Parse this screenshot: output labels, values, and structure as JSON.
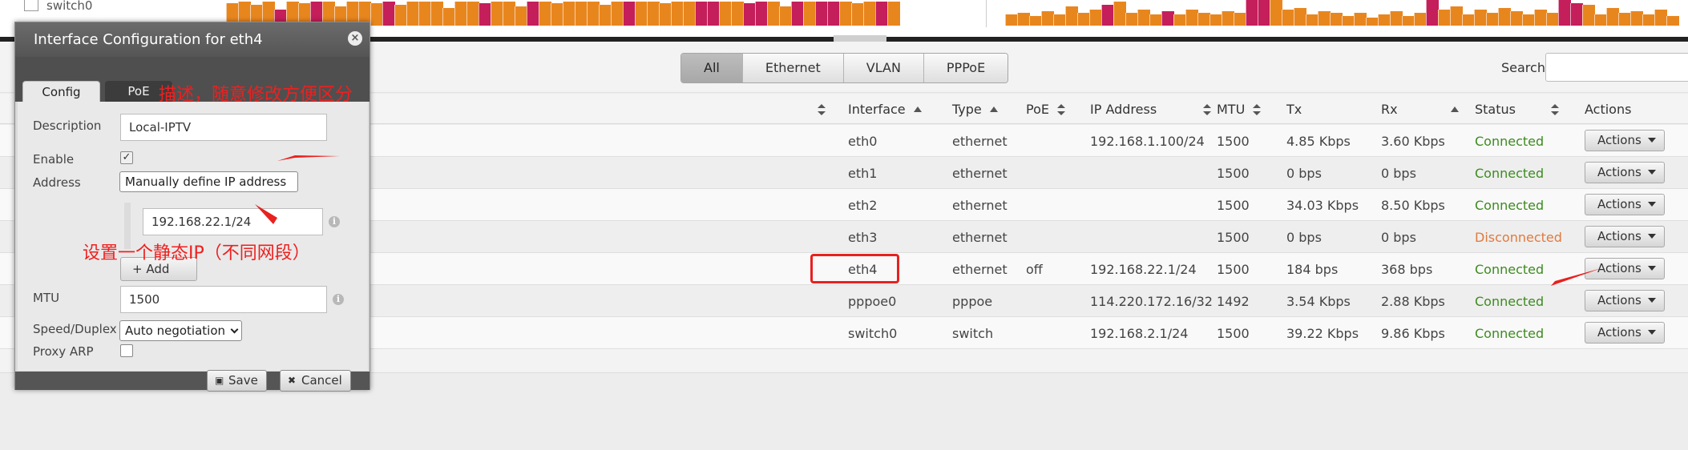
{
  "graphs": {
    "legend_label": "switch0",
    "colors": {
      "tx": "#e8861e",
      "rx": "#c41e5b"
    },
    "left_bars": [
      {
        "c": "tx",
        "h": 28
      },
      {
        "c": "tx",
        "h": 30
      },
      {
        "c": "tx",
        "h": 26
      },
      {
        "c": "tx",
        "h": 30
      },
      {
        "c": "rx",
        "h": 20
      },
      {
        "c": "tx",
        "h": 30
      },
      {
        "c": "tx",
        "h": 28
      },
      {
        "c": "rx",
        "h": 30
      },
      {
        "c": "tx",
        "h": 30
      },
      {
        "c": "tx",
        "h": 24
      },
      {
        "c": "tx",
        "h": 30
      },
      {
        "c": "tx",
        "h": 30
      },
      {
        "c": "tx",
        "h": 28
      },
      {
        "c": "rx",
        "h": 30
      },
      {
        "c": "tx",
        "h": 26
      },
      {
        "c": "tx",
        "h": 30
      },
      {
        "c": "tx",
        "h": 30
      },
      {
        "c": "tx",
        "h": 30
      },
      {
        "c": "tx",
        "h": 22
      },
      {
        "c": "tx",
        "h": 30
      },
      {
        "c": "tx",
        "h": 30
      },
      {
        "c": "rx",
        "h": 28
      },
      {
        "c": "tx",
        "h": 30
      },
      {
        "c": "tx",
        "h": 30
      },
      {
        "c": "tx",
        "h": 24
      },
      {
        "c": "rx",
        "h": 30
      },
      {
        "c": "tx",
        "h": 30
      },
      {
        "c": "tx",
        "h": 28
      },
      {
        "c": "tx",
        "h": 30
      },
      {
        "c": "tx",
        "h": 30
      },
      {
        "c": "tx",
        "h": 30
      },
      {
        "c": "tx",
        "h": 26
      },
      {
        "c": "tx",
        "h": 30
      },
      {
        "c": "rx",
        "h": 30
      },
      {
        "c": "tx",
        "h": 30
      },
      {
        "c": "tx",
        "h": 30
      },
      {
        "c": "tx",
        "h": 28
      },
      {
        "c": "tx",
        "h": 30
      },
      {
        "c": "tx",
        "h": 30
      },
      {
        "c": "rx",
        "h": 30
      },
      {
        "c": "rx",
        "h": 30
      },
      {
        "c": "tx",
        "h": 30
      },
      {
        "c": "tx",
        "h": 30
      },
      {
        "c": "rx",
        "h": 28
      },
      {
        "c": "rx",
        "h": 30
      },
      {
        "c": "tx",
        "h": 30
      },
      {
        "c": "tx",
        "h": 24
      },
      {
        "c": "rx",
        "h": 30
      },
      {
        "c": "tx",
        "h": 30
      },
      {
        "c": "rx",
        "h": 30
      },
      {
        "c": "rx",
        "h": 30
      },
      {
        "c": "tx",
        "h": 30
      },
      {
        "c": "tx",
        "h": 28
      },
      {
        "c": "tx",
        "h": 30
      },
      {
        "c": "rx",
        "h": 30
      },
      {
        "c": "tx",
        "h": 30
      }
    ],
    "right_bars": [
      {
        "c": "tx",
        "h": 14
      },
      {
        "c": "tx",
        "h": 16
      },
      {
        "c": "tx",
        "h": 12
      },
      {
        "c": "tx",
        "h": 18
      },
      {
        "c": "tx",
        "h": 14
      },
      {
        "c": "tx",
        "h": 24
      },
      {
        "c": "tx",
        "h": 16
      },
      {
        "c": "tx",
        "h": 20
      },
      {
        "c": "rx",
        "h": 26
      },
      {
        "c": "tx",
        "h": 30
      },
      {
        "c": "tx",
        "h": 16
      },
      {
        "c": "tx",
        "h": 20
      },
      {
        "c": "tx",
        "h": 14
      },
      {
        "c": "rx",
        "h": 18
      },
      {
        "c": "tx",
        "h": 14
      },
      {
        "c": "tx",
        "h": 20
      },
      {
        "c": "tx",
        "h": 16
      },
      {
        "c": "tx",
        "h": 14
      },
      {
        "c": "tx",
        "h": 18
      },
      {
        "c": "tx",
        "h": 16
      },
      {
        "c": "rx",
        "h": 34
      },
      {
        "c": "rx",
        "h": 34
      },
      {
        "c": "tx",
        "h": 34
      },
      {
        "c": "tx",
        "h": 20
      },
      {
        "c": "tx",
        "h": 22
      },
      {
        "c": "tx",
        "h": 14
      },
      {
        "c": "tx",
        "h": 18
      },
      {
        "c": "tx",
        "h": 16
      },
      {
        "c": "tx",
        "h": 12
      },
      {
        "c": "tx",
        "h": 16
      },
      {
        "c": "tx",
        "h": 10
      },
      {
        "c": "tx",
        "h": 14
      },
      {
        "c": "tx",
        "h": 18
      },
      {
        "c": "tx",
        "h": 12
      },
      {
        "c": "tx",
        "h": 16
      },
      {
        "c": "rx",
        "h": 34
      },
      {
        "c": "tx",
        "h": 20
      },
      {
        "c": "tx",
        "h": 24
      },
      {
        "c": "tx",
        "h": 14
      },
      {
        "c": "tx",
        "h": 20
      },
      {
        "c": "tx",
        "h": 16
      },
      {
        "c": "tx",
        "h": 22
      },
      {
        "c": "tx",
        "h": 18
      },
      {
        "c": "tx",
        "h": 14
      },
      {
        "c": "tx",
        "h": 20
      },
      {
        "c": "tx",
        "h": 16
      },
      {
        "c": "rx",
        "h": 34
      },
      {
        "c": "rx",
        "h": 28
      },
      {
        "c": "tx",
        "h": 26
      },
      {
        "c": "tx",
        "h": 14
      },
      {
        "c": "tx",
        "h": 22
      },
      {
        "c": "tx",
        "h": 16
      },
      {
        "c": "tx",
        "h": 18
      },
      {
        "c": "tx",
        "h": 14
      },
      {
        "c": "tx",
        "h": 20
      },
      {
        "c": "tx",
        "h": 12
      }
    ]
  },
  "filter": {
    "buttons": [
      "All",
      "Ethernet",
      "VLAN",
      "PPPoE"
    ],
    "active": "All",
    "search_label": "Search",
    "search_value": ""
  },
  "table": {
    "headers": {
      "interface": "Interface",
      "type": "Type",
      "poe": "PoE",
      "ip": "IP Address",
      "mtu": "MTU",
      "tx": "Tx",
      "rx": "Rx",
      "status": "Status",
      "actions": "Actions"
    },
    "rows": [
      {
        "interface": "eth0",
        "type": "ethernet",
        "poe": "",
        "ip": "192.168.1.100/24",
        "mtu": "1500",
        "tx": "4.85 Kbps",
        "rx": "3.60 Kbps",
        "status": "Connected",
        "ok": true,
        "action": "Actions"
      },
      {
        "interface": "eth1",
        "type": "ethernet",
        "poe": "",
        "ip": "",
        "mtu": "1500",
        "tx": "0 bps",
        "rx": "0 bps",
        "status": "Connected",
        "ok": true,
        "action": "Actions"
      },
      {
        "interface": "eth2",
        "type": "ethernet",
        "poe": "",
        "ip": "",
        "mtu": "1500",
        "tx": "34.03 Kbps",
        "rx": "8.50 Kbps",
        "status": "Connected",
        "ok": true,
        "action": "Actions"
      },
      {
        "interface": "eth3",
        "type": "ethernet",
        "poe": "",
        "ip": "",
        "mtu": "1500",
        "tx": "0 bps",
        "rx": "0 bps",
        "status": "Disconnected",
        "ok": false,
        "action": "Actions"
      },
      {
        "interface": "eth4",
        "type": "ethernet",
        "poe": "off",
        "ip": "192.168.22.1/24",
        "mtu": "1500",
        "tx": "184 bps",
        "rx": "368 bps",
        "status": "Connected",
        "ok": true,
        "action": "Actions"
      },
      {
        "interface": "pppoe0",
        "type": "pppoe",
        "poe": "",
        "ip": "114.220.172.16/32",
        "mtu": "1492",
        "tx": "3.54 Kbps",
        "rx": "2.88 Kbps",
        "status": "Connected",
        "ok": true,
        "action": "Actions"
      },
      {
        "interface": "switch0",
        "type": "switch",
        "poe": "",
        "ip": "192.168.2.1/24",
        "mtu": "1500",
        "tx": "39.22 Kbps",
        "rx": "9.86 Kbps",
        "status": "Connected",
        "ok": true,
        "action": "Actions"
      }
    ]
  },
  "dialog": {
    "title": "Interface Configuration for eth4",
    "close_glyph": "×",
    "tabs": {
      "config": "Config",
      "poe": "PoE"
    },
    "description_label": "Description",
    "description_value": "Local-IPTV",
    "enable_label": "Enable",
    "enable_checked": true,
    "address_label": "Address",
    "address_mode": "Manually define IP address",
    "address_value": "192.168.22.1/24",
    "add_label": "+ Add",
    "mtu_label": "MTU",
    "mtu_value": "1500",
    "speed_label": "Speed/Duplex",
    "speed_value": "Auto negotiation",
    "proxy_arp_label": "Proxy ARP",
    "proxy_arp_checked": false,
    "save_label": "Save",
    "cancel_label": "Cancel",
    "info_glyph": "i",
    "check_glyph": "✓"
  },
  "annotations": {
    "description_note": "描述，随意修改方便区分",
    "ip_note": "设置一个静态IP（不同网段）",
    "color": "#e8211f"
  }
}
